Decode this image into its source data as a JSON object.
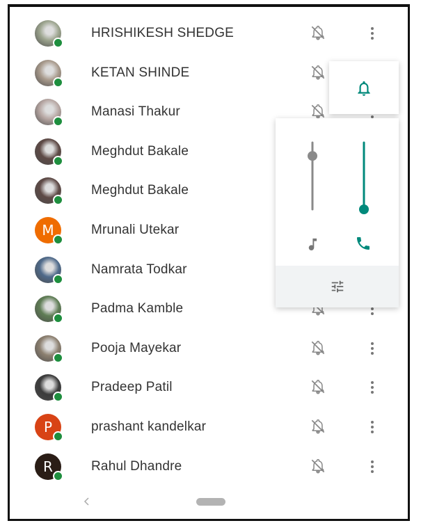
{
  "contacts": [
    {
      "name": "HRISHIKESH SHEDGE",
      "avatar_color": "#9ca48e",
      "avatar_letter": ""
    },
    {
      "name": "KETAN SHINDE",
      "avatar_color": "#a89a8c",
      "avatar_letter": ""
    },
    {
      "name": "Manasi Thakur",
      "avatar_color": "#b7a7a3",
      "avatar_letter": ""
    },
    {
      "name": "Meghdut Bakale",
      "avatar_color": "#5e4a46",
      "avatar_letter": ""
    },
    {
      "name": "Meghdut Bakale",
      "avatar_color": "#5e4a46",
      "avatar_letter": ""
    },
    {
      "name": "Mrunali Utekar",
      "avatar_color": "#ef6c00",
      "avatar_letter": "M"
    },
    {
      "name": "Namrata Todkar",
      "avatar_color": "#4f6a8a",
      "avatar_letter": ""
    },
    {
      "name": "Padma Kamble",
      "avatar_color": "#5f7d55",
      "avatar_letter": ""
    },
    {
      "name": "Pooja Mayekar",
      "avatar_color": "#8c8070",
      "avatar_letter": ""
    },
    {
      "name": "Pradeep Patil",
      "avatar_color": "#3b3b3b",
      "avatar_letter": ""
    },
    {
      "name": "prashant kandelkar",
      "avatar_color": "#d84315",
      "avatar_letter": "P"
    },
    {
      "name": "Rahul Dhandre",
      "avatar_color": "#2a1d16",
      "avatar_letter": "R"
    }
  ],
  "volume_panel": {
    "accent": "#00897b",
    "media_level": 0.8,
    "call_level": 0.0
  },
  "colors": {
    "status": "#1e8e3e",
    "icon": "#888888"
  }
}
